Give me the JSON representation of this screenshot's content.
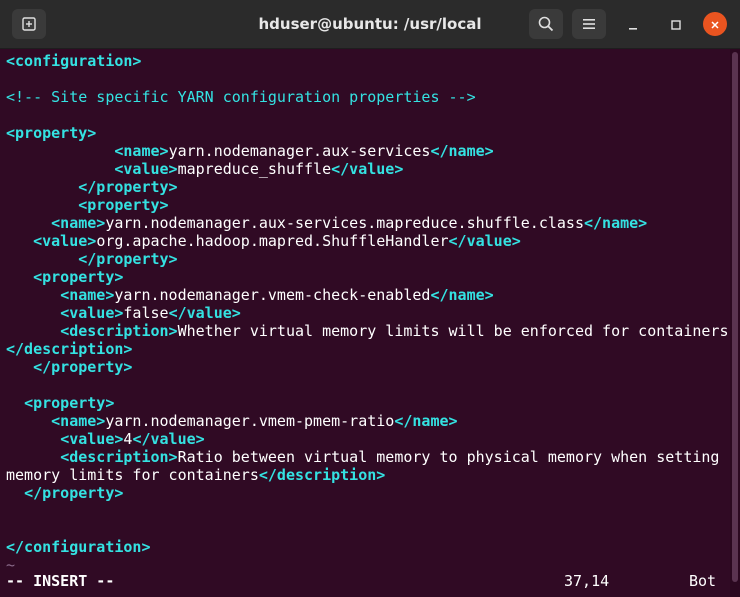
{
  "window": {
    "title": "hduser@ubuntu: /usr/local"
  },
  "toolbar": {
    "new_tab_icon": "new-tab-icon",
    "search_icon": "search-icon",
    "menu_icon": "hamburger-menu-icon",
    "minimize_icon": "minimize-icon",
    "maximize_icon": "maximize-icon",
    "close_icon": "close-icon",
    "close_color": "#e95420"
  },
  "editor": {
    "lines": [
      [
        {
          "t": "tag",
          "v": "<configuration>"
        }
      ],
      [
        {
          "t": "comment",
          "v": "<!-- Site specific YARN configuration properties -->"
        }
      ],
      [
        {
          "t": "tag",
          "v": "<property>"
        }
      ],
      [
        {
          "t": "txt",
          "v": "            "
        },
        {
          "t": "tag",
          "v": "<name>"
        },
        {
          "t": "txt",
          "v": "yarn.nodemanager.aux-services"
        },
        {
          "t": "tag",
          "v": "</name>"
        }
      ],
      [
        {
          "t": "txt",
          "v": "            "
        },
        {
          "t": "tag",
          "v": "<value>"
        },
        {
          "t": "txt",
          "v": "mapreduce_shuffle"
        },
        {
          "t": "tag",
          "v": "</value>"
        }
      ],
      [
        {
          "t": "txt",
          "v": "        "
        },
        {
          "t": "tag",
          "v": "</property>"
        }
      ],
      [
        {
          "t": "txt",
          "v": "        "
        },
        {
          "t": "tag",
          "v": "<property>"
        }
      ],
      [
        {
          "t": "txt",
          "v": "     "
        },
        {
          "t": "tag",
          "v": "<name>"
        },
        {
          "t": "txt",
          "v": "yarn.nodemanager.aux-services.mapreduce.shuffle.class"
        },
        {
          "t": "tag",
          "v": "</name>"
        }
      ],
      [
        {
          "t": "txt",
          "v": "   "
        },
        {
          "t": "tag",
          "v": "<value>"
        },
        {
          "t": "txt",
          "v": "org.apache.hadoop.mapred.ShuffleHandler"
        },
        {
          "t": "tag",
          "v": "</value>"
        }
      ],
      [
        {
          "t": "txt",
          "v": "        "
        },
        {
          "t": "tag",
          "v": "</property>"
        }
      ],
      [
        {
          "t": "txt",
          "v": "   "
        },
        {
          "t": "tag",
          "v": "<property>"
        }
      ],
      [
        {
          "t": "txt",
          "v": "      "
        },
        {
          "t": "tag",
          "v": "<name>"
        },
        {
          "t": "txt",
          "v": "yarn.nodemanager.vmem-check-enabled"
        },
        {
          "t": "tag",
          "v": "</name>"
        }
      ],
      [
        {
          "t": "txt",
          "v": "      "
        },
        {
          "t": "tag",
          "v": "<value>"
        },
        {
          "t": "txt",
          "v": "false"
        },
        {
          "t": "tag",
          "v": "</value>"
        }
      ],
      [
        {
          "t": "txt",
          "v": "      "
        },
        {
          "t": "tag",
          "v": "<description>"
        },
        {
          "t": "txt",
          "v": "Whether virtual memory limits will be enforced for containers"
        }
      ],
      [
        {
          "t": "tag",
          "v": "</description>"
        }
      ],
      [
        {
          "t": "txt",
          "v": "   "
        },
        {
          "t": "tag",
          "v": "</property>"
        }
      ],
      [
        {
          "t": "txt",
          "v": "  "
        },
        {
          "t": "tag",
          "v": "<property>"
        }
      ],
      [
        {
          "t": "txt",
          "v": "     "
        },
        {
          "t": "tag",
          "v": "<name>"
        },
        {
          "t": "txt",
          "v": "yarn.nodemanager.vmem-pmem-ratio"
        },
        {
          "t": "tag",
          "v": "</name>"
        }
      ],
      [
        {
          "t": "txt",
          "v": "      "
        },
        {
          "t": "tag",
          "v": "<value>"
        },
        {
          "t": "txt",
          "v": "4"
        },
        {
          "t": "tag",
          "v": "</value>"
        }
      ],
      [
        {
          "t": "txt",
          "v": "      "
        },
        {
          "t": "tag",
          "v": "<description>"
        },
        {
          "t": "txt",
          "v": "Ratio between virtual memory to physical memory when setting"
        }
      ],
      [
        {
          "t": "txt",
          "v": "memory limits for containers"
        },
        {
          "t": "tag",
          "v": "</description>"
        }
      ],
      [
        {
          "t": "txt",
          "v": "  "
        },
        {
          "t": "tag",
          "v": "</property>"
        }
      ],
      [
        {
          "t": "tag",
          "v": "</configuration>"
        }
      ],
      [
        {
          "t": "tilde",
          "v": "~"
        }
      ]
    ]
  },
  "statusbar": {
    "mode": "-- INSERT --",
    "cursor": "37,14",
    "scroll": "Bot"
  }
}
